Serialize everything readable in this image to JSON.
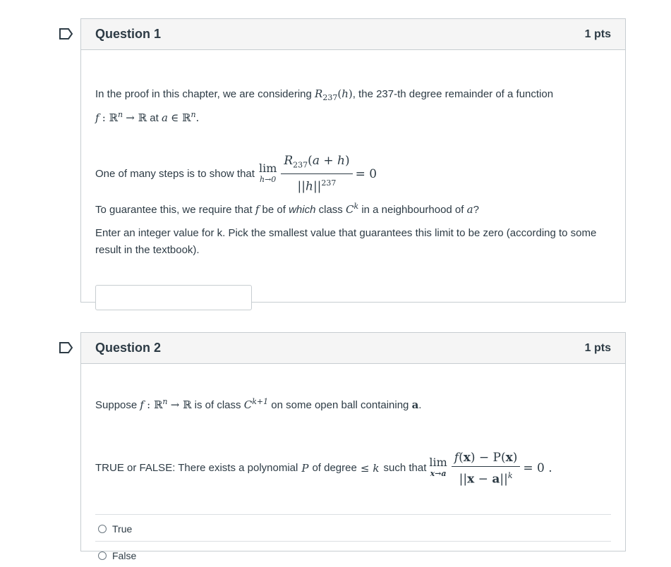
{
  "questions": [
    {
      "title": "Question 1",
      "points": "1 pts",
      "intro_a": "In the proof in this chapter, we are considering",
      "intro_b": ", the 237-th degree remainder of a function",
      "intro_c": "at",
      "step_text": "One of many steps is to show that",
      "guarantee_a": "To guarantee this, we require that",
      "guarantee_b": "be of",
      "guarantee_em": "which",
      "guarantee_c": "class",
      "guarantee_d": "in a neighbourhood of",
      "instructions": "Enter an integer value for k. Pick the smallest value that guarantees this limit to be zero (according to some result in the textbook).",
      "answer_value": ""
    },
    {
      "title": "Question 2",
      "points": "1 pts",
      "suppose_a": "Suppose",
      "suppose_b": "is of class",
      "suppose_c": "on some open ball containing",
      "tf_a": "TRUE or FALSE: There exists a polynomial",
      "tf_b": "of degree",
      "tf_c": "such that",
      "options": [
        "True",
        "False"
      ]
    }
  ],
  "icons": {
    "flag": "flag-outline-icon",
    "radio": "radio-empty-icon"
  },
  "colors": {
    "text": "#2d3b45",
    "border": "#c7cdd1",
    "header_bg": "#f5f5f5"
  }
}
